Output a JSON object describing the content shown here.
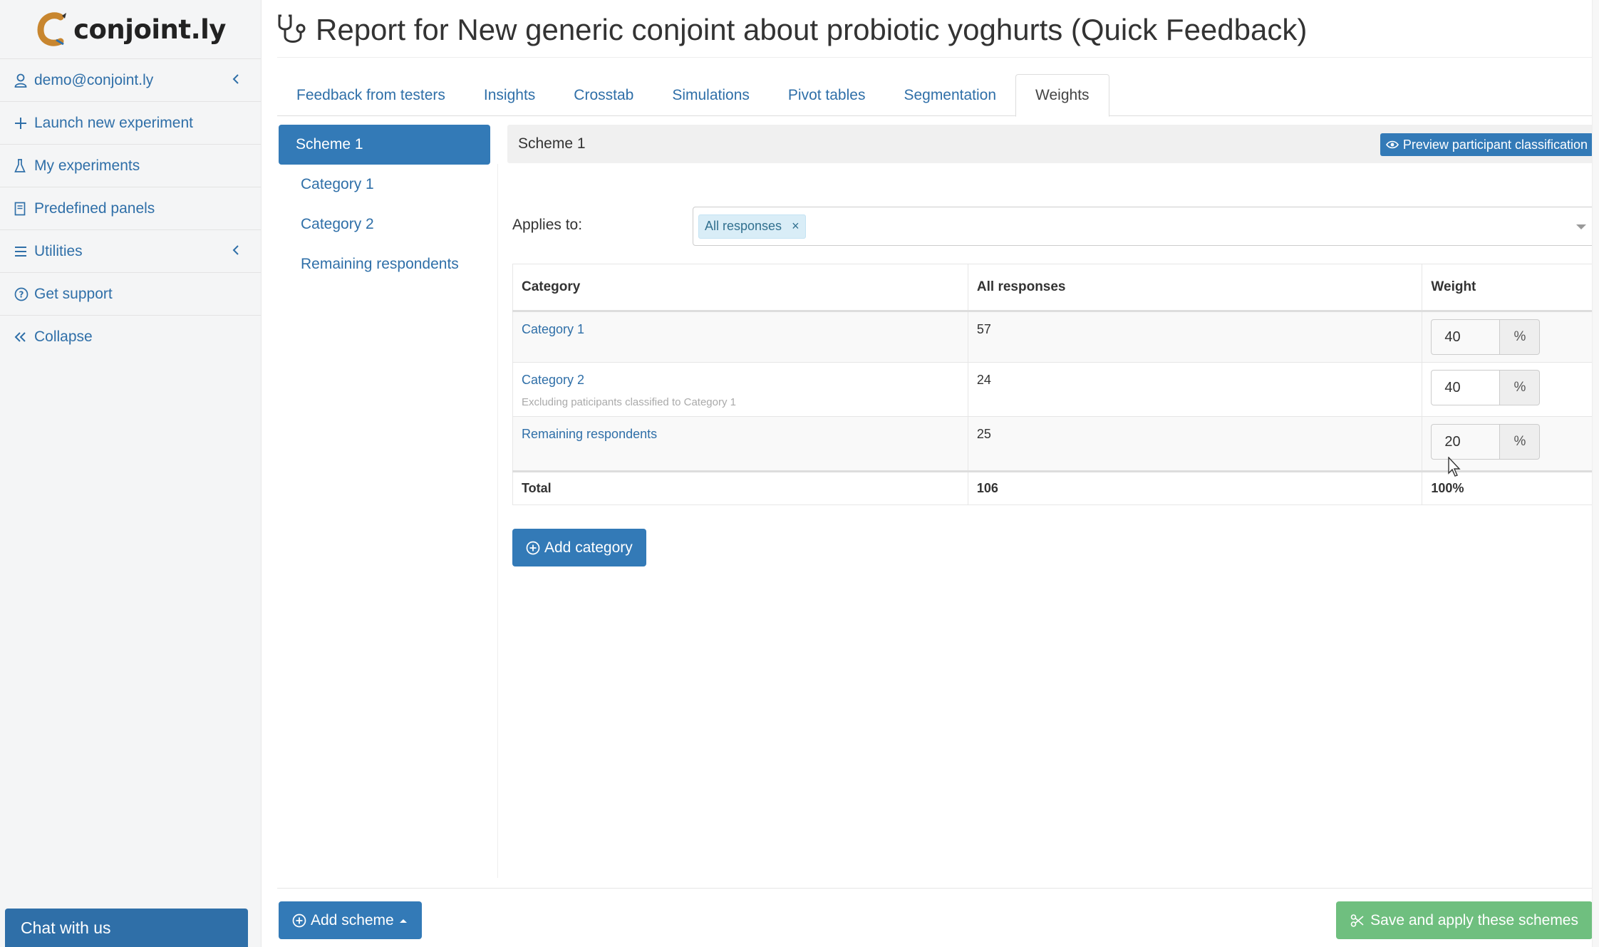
{
  "brand": {
    "name": "conjoint.ly"
  },
  "sidebar": {
    "items": [
      {
        "label": "demo@conjoint.ly",
        "icon": "user-icon",
        "has_chevron": true
      },
      {
        "label": "Launch new experiment",
        "icon": "plus-icon"
      },
      {
        "label": "My experiments",
        "icon": "flask-icon"
      },
      {
        "label": "Predefined panels",
        "icon": "book-icon"
      },
      {
        "label": "Utilities",
        "icon": "menu-icon",
        "has_chevron": true
      },
      {
        "label": "Get support",
        "icon": "question-circle-icon"
      },
      {
        "label": "Collapse",
        "icon": "double-chevron-left-icon"
      }
    ],
    "chat_label": "Chat with us"
  },
  "page": {
    "title": "Report for New generic conjoint about probiotic yoghurts (Quick Feedback)",
    "title_icon": "stethoscope-icon"
  },
  "tabs": [
    {
      "label": "Feedback from testers"
    },
    {
      "label": "Insights"
    },
    {
      "label": "Crosstab"
    },
    {
      "label": "Simulations"
    },
    {
      "label": "Pivot tables"
    },
    {
      "label": "Segmentation"
    },
    {
      "label": "Weights",
      "active": true
    }
  ],
  "schemes": {
    "items": [
      {
        "label": "Scheme 1",
        "active": true
      },
      {
        "label": "Category 1"
      },
      {
        "label": "Category 2"
      },
      {
        "label": "Remaining respondents"
      }
    ]
  },
  "panel": {
    "title": "Scheme 1",
    "preview_label": "Preview participant classification",
    "applies_to_label": "Applies to:",
    "applies_to_tag": "All responses",
    "tag_remove": "×"
  },
  "table": {
    "headers": {
      "category": "Category",
      "responses": "All responses",
      "weight": "Weight"
    },
    "rows": [
      {
        "category": "Category 1",
        "note": "",
        "responses": "57",
        "weight": "40"
      },
      {
        "category": "Category 2",
        "note": "Excluding paticipants classified to Category 1",
        "responses": "24",
        "weight": "40"
      },
      {
        "category": "Remaining respondents",
        "note": "",
        "responses": "25",
        "weight": "20"
      }
    ],
    "unit": "%",
    "total": {
      "label": "Total",
      "responses": "106",
      "weight": "100%"
    }
  },
  "buttons": {
    "add_category": "Add category",
    "add_scheme": "Add scheme",
    "save": "Save and apply these schemes"
  },
  "colors": {
    "primary": "#337ab7",
    "link": "#2f6fa8",
    "success": "#6fbf7f",
    "tag_bg": "#d9edf7"
  }
}
